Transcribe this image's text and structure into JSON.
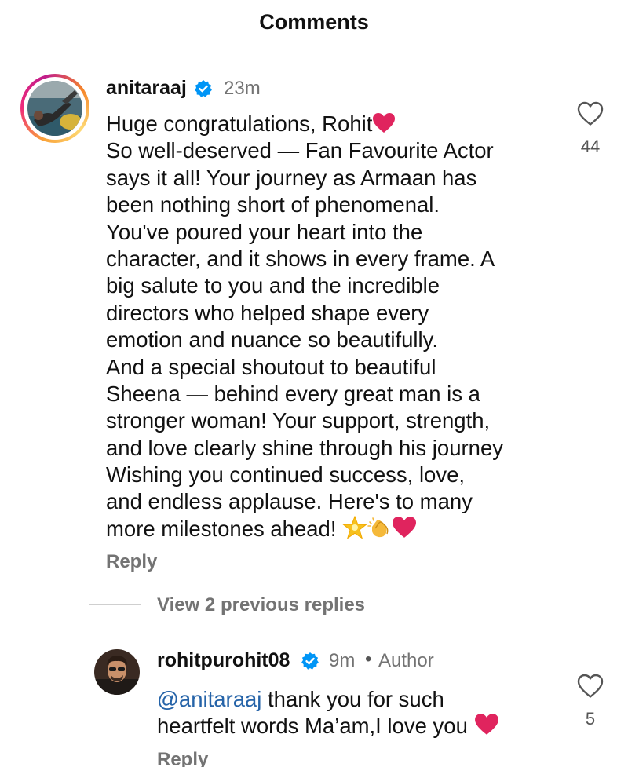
{
  "header": {
    "title": "Comments"
  },
  "comment": {
    "username": "anitaraaj",
    "time": "23m",
    "lines": [
      "Huge congratulations, Rohit",
      "So well-deserved — Fan Favourite Actor",
      "says it all! Your journey as Armaan has",
      "been nothing short of phenomenal.",
      "You've poured your heart into the",
      "character, and it shows in every frame. A",
      "big salute to you and the incredible",
      "directors who helped shape every",
      "emotion and nuance so beautifully.",
      "And a special shoutout to beautiful",
      "Sheena — behind every great man is a",
      "stronger woman! Your support, strength,",
      "and love clearly shine through his journey",
      "Wishing you continued success, love,",
      "and endless applause. Here's to many",
      "more milestones ahead!"
    ],
    "reply_label": "Reply",
    "like_count": "44",
    "like_icon": "heart-outline-icon"
  },
  "view_replies": {
    "label": "View 2 previous replies"
  },
  "reply": {
    "username": "rohitpurohit08",
    "time": "9m",
    "separator": "•",
    "badge": "Author",
    "mention": "@anitaraaj",
    "line1_text": " thank you for such",
    "line2_text": "heartfelt words Ma’am,I love you",
    "reply_label": "Reply",
    "like_count": "5",
    "like_icon": "heart-outline-icon"
  },
  "colors": {
    "verified_blue": "#0095f6",
    "heart_red": "#e0245e",
    "mention_blue": "#2563a8",
    "muted_gray": "#737373"
  }
}
